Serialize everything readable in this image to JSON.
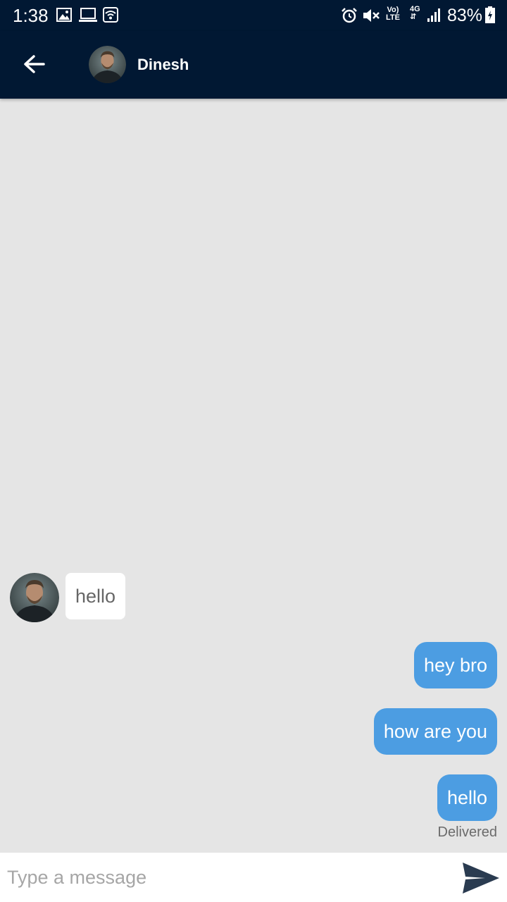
{
  "status_bar": {
    "time": "1:38",
    "volte_top": "Vo)",
    "volte_bottom": "LTE",
    "network": "4G",
    "battery": "83%",
    "icons": [
      "image-icon",
      "laptop-icon",
      "wifi-icon",
      "alarm-icon",
      "mute-icon",
      "volte-icon",
      "signal-icon",
      "battery-charging-icon"
    ]
  },
  "header": {
    "back_icon": "arrow-back-icon",
    "contact_name": "Dinesh"
  },
  "messages": [
    {
      "direction": "incoming",
      "text": "hello"
    },
    {
      "direction": "outgoing",
      "text": "hey bro"
    },
    {
      "direction": "outgoing",
      "text": "how are you"
    },
    {
      "direction": "outgoing",
      "text": "hello"
    }
  ],
  "delivery_status": "Delivered",
  "composer": {
    "placeholder": "Type a message",
    "value": "",
    "send_icon": "send-icon"
  },
  "colors": {
    "app_bar": "#011833",
    "chat_background": "#e5e5e5",
    "outgoing_bubble": "#4c9de2",
    "incoming_bubble": "#ffffff",
    "send_icon": "#2a3b50"
  }
}
